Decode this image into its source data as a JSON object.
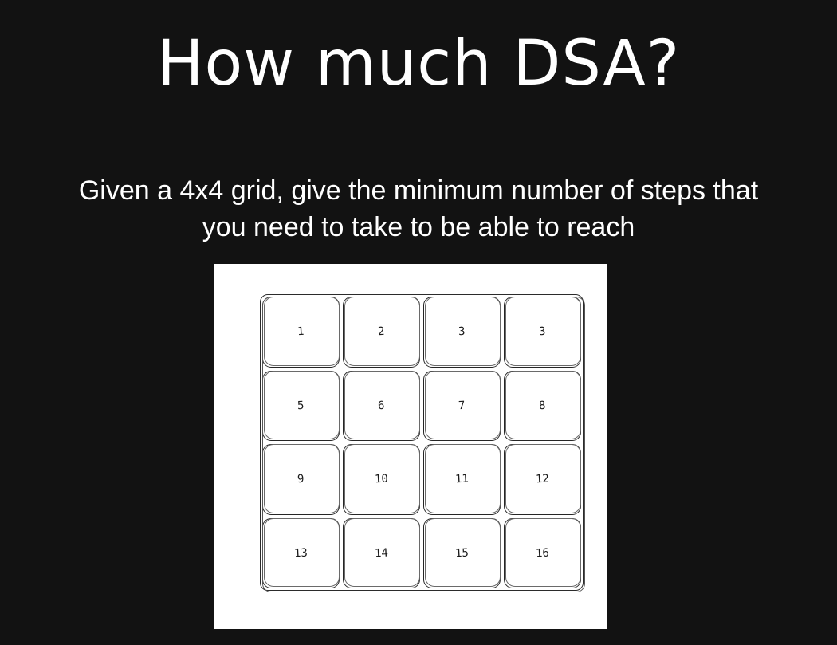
{
  "slide": {
    "title": "How much DSA?",
    "question_line1": "Given a 4x4 grid, give the minimum number of steps that",
    "question_line2": "you need to take to be able to reach"
  },
  "grid": {
    "rows": 4,
    "cols": 4,
    "cells": [
      "1",
      "2",
      "3",
      "3",
      "5",
      "6",
      "7",
      "8",
      "9",
      "10",
      "11",
      "12",
      "13",
      "14",
      "15",
      "16"
    ]
  }
}
